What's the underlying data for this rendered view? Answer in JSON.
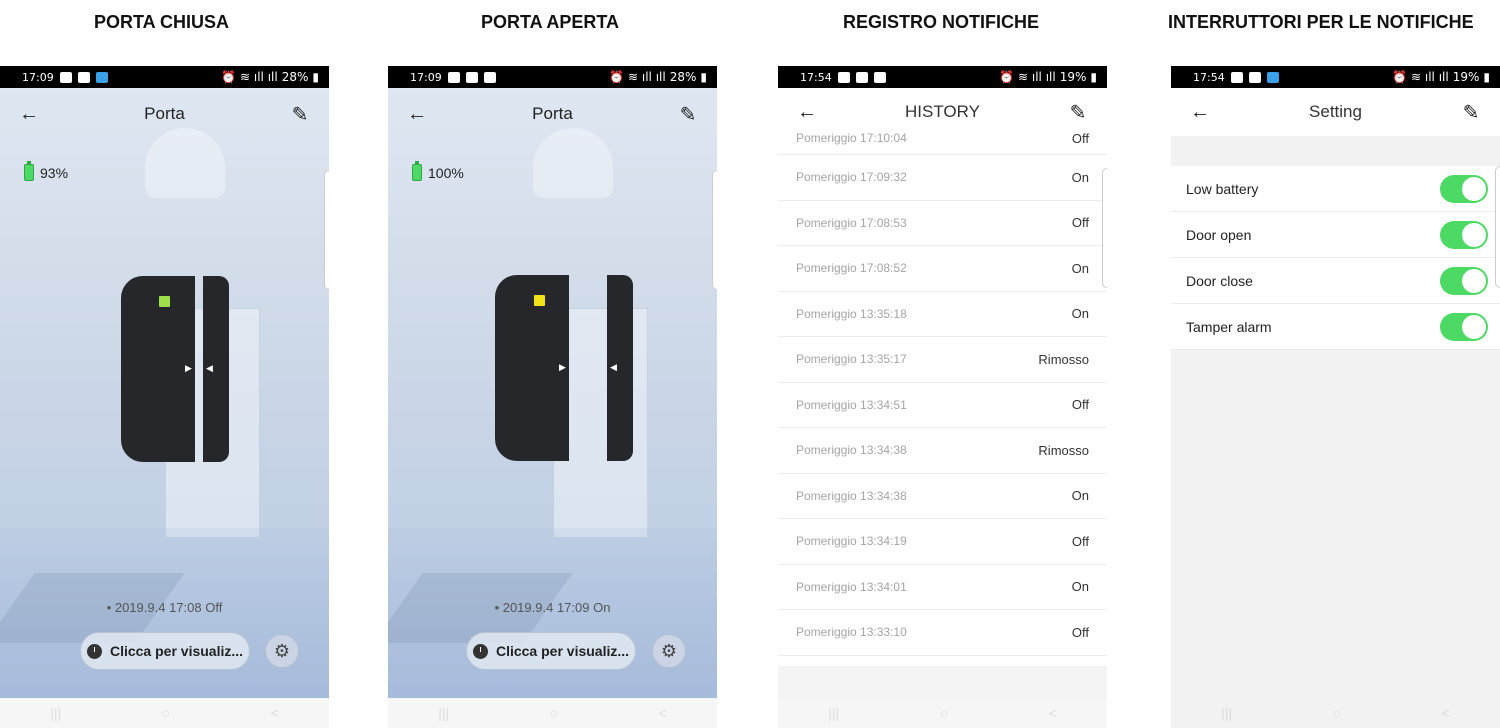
{
  "captions": [
    "PORTA CHIUSA",
    "PORTA APERTA",
    "REGISTRO NOTIFICHE",
    "INTERRUTTORI PER LE NOTIFICHE"
  ],
  "phone1": {
    "status": {
      "time": "17:09",
      "battery": "28%"
    },
    "title": "Porta",
    "battery": "93%",
    "led_color": "#9ee04a",
    "last_event": "• 2019.9.4 17:08 Off",
    "view_button": "Clicca per visualiz..."
  },
  "phone2": {
    "status": {
      "time": "17:09",
      "battery": "28%"
    },
    "title": "Porta",
    "battery": "100%",
    "led_color": "#f2e21a",
    "last_event": "• 2019.9.4 17:09 On",
    "view_button": "Clicca per visualiz..."
  },
  "phone3": {
    "status": {
      "time": "17:54",
      "battery": "19%"
    },
    "title": "HISTORY",
    "rows": [
      {
        "time": "Pomeriggio  17:10:04",
        "state": "Off"
      },
      {
        "time": "Pomeriggio  17:09:32",
        "state": "On"
      },
      {
        "time": "Pomeriggio  17:08:53",
        "state": "Off"
      },
      {
        "time": "Pomeriggio  17:08:52",
        "state": "On"
      },
      {
        "time": "Pomeriggio  13:35:18",
        "state": "On"
      },
      {
        "time": "Pomeriggio  13:35:17",
        "state": "Rimosso"
      },
      {
        "time": "Pomeriggio  13:34:51",
        "state": "Off"
      },
      {
        "time": "Pomeriggio  13:34:38",
        "state": "Rimosso"
      },
      {
        "time": "Pomeriggio  13:34:38",
        "state": "On"
      },
      {
        "time": "Pomeriggio  13:34:19",
        "state": "Off"
      },
      {
        "time": "Pomeriggio  13:34:01",
        "state": "On"
      },
      {
        "time": "Pomeriggio  13:33:10",
        "state": "Off"
      }
    ]
  },
  "phone4": {
    "status": {
      "time": "17:54",
      "battery": "19%"
    },
    "title": "Setting",
    "items": [
      {
        "label": "Low battery",
        "enabled": true
      },
      {
        "label": "Door open",
        "enabled": true
      },
      {
        "label": "Door close",
        "enabled": true
      },
      {
        "label": "Tamper alarm",
        "enabled": true
      }
    ]
  },
  "toggle_color": "#4cd964"
}
